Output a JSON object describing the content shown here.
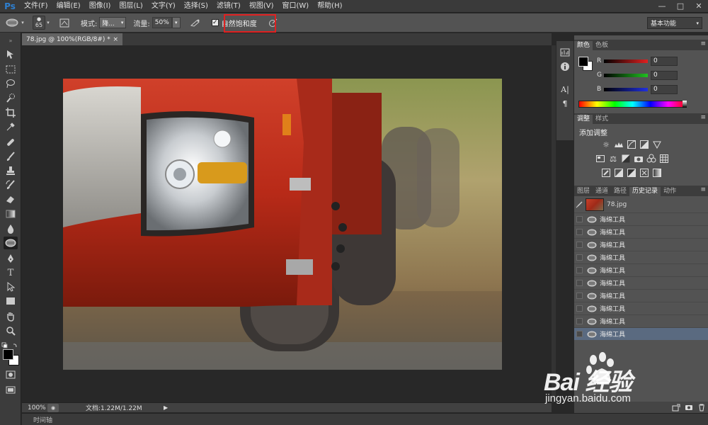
{
  "app": {
    "logo": "Ps",
    "menu": [
      "文件(F)",
      "编辑(E)",
      "图像(I)",
      "图层(L)",
      "文字(Y)",
      "选择(S)",
      "滤镜(T)",
      "视图(V)",
      "窗口(W)",
      "帮助(H)"
    ],
    "window_controls": [
      "—",
      "□",
      "✕"
    ]
  },
  "options": {
    "brush_size": "65",
    "mode_label": "模式:",
    "mode_value": "降...",
    "flow_label": "流量:",
    "flow_value": "50%",
    "vibrance_label": "自然饱和度",
    "vibrance_checked": true,
    "workspace": "基本功能",
    "highlight_color": "#e02020"
  },
  "document": {
    "tab_title": "78.jpg @ 100%(RGB/8#) *",
    "tab_close": "×",
    "zoom": "100%",
    "doc_size": "文档:1.22M/1.22M"
  },
  "timeline": {
    "label": "时间轴"
  },
  "color_panel": {
    "tabs": [
      "颜色",
      "色板"
    ],
    "channels": [
      {
        "label": "R",
        "value": "0",
        "ramp": "#e02020"
      },
      {
        "label": "G",
        "value": "0",
        "ramp": "#20c020"
      },
      {
        "label": "B",
        "value": "0",
        "ramp": "#2030e0"
      }
    ]
  },
  "adjust_panel": {
    "tabs": [
      "调整",
      "样式"
    ],
    "title": "添加调整"
  },
  "history_panel": {
    "tabs": [
      "图层",
      "通道",
      "路径",
      "历史记录",
      "动作"
    ],
    "snapshot": "78.jpg",
    "items": [
      "海绵工具",
      "海绵工具",
      "海绵工具",
      "海绵工具",
      "海绵工具",
      "海绵工具",
      "海绵工具",
      "海绵工具",
      "海绵工具",
      "海绵工具"
    ],
    "selected_index": 9
  },
  "watermark": {
    "logo": "Bai 经验",
    "url": "jingyan.baidu.com"
  }
}
